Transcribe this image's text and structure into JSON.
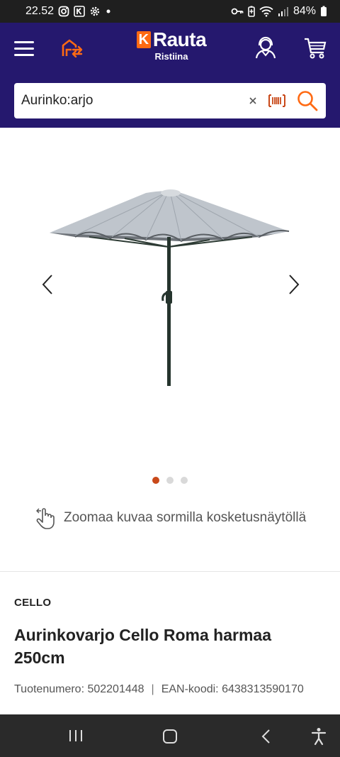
{
  "status_bar": {
    "time": "22.52",
    "battery": "84%",
    "left_icons": [
      "instagram-icon",
      "k-app-icon",
      "settings-icon",
      "dot-icon"
    ],
    "right_icons": [
      "vpn-key-icon",
      "battery-saver-icon",
      "wifi-icon",
      "signal-icon",
      "battery-icon"
    ]
  },
  "header": {
    "logo_k": "K",
    "logo_word": "Rauta",
    "store_name": "Ristiina",
    "background_color": "#25186e",
    "accent_color": "#ff6a13"
  },
  "search": {
    "value": "Aurinko:arjo",
    "clear_icon": "close-icon",
    "barcode_icon": "barcode-icon",
    "search_icon": "search-icon"
  },
  "gallery": {
    "image_alt_icon": "parasol-icon",
    "current_index": 0,
    "count": 3,
    "active_dot_color": "#c9491a"
  },
  "zoom_hint": {
    "text": "Zoomaa kuvaa sormilla kosketusnäytöllä",
    "icon": "touch-gesture-icon"
  },
  "product": {
    "brand": "CELLO",
    "title": "Aurinkovarjo Cello Roma harmaa 250cm",
    "product_number": "Tuotenumero: 502201448",
    "separator": "|",
    "ean": "EAN-koodi: 6438313590170"
  },
  "nav_bar": {
    "buttons": [
      "recent-apps-icon",
      "home-icon",
      "back-icon",
      "accessibility-icon"
    ]
  }
}
